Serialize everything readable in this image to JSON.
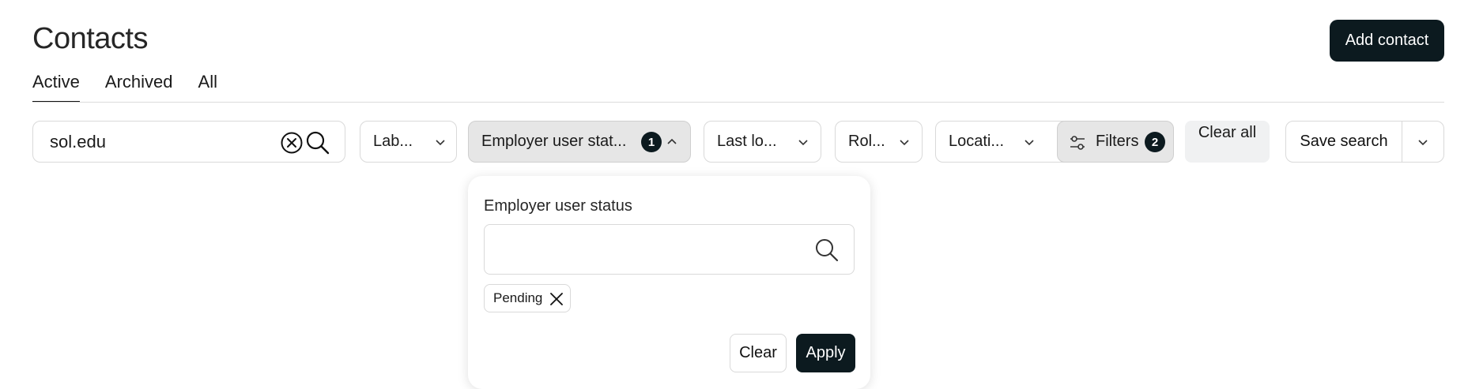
{
  "page": {
    "title": "Contacts",
    "add_button": "Add contact"
  },
  "tabs": [
    {
      "label": "Active",
      "active": true
    },
    {
      "label": "Archived",
      "active": false
    },
    {
      "label": "All",
      "active": false
    }
  ],
  "search": {
    "value": "sol.edu"
  },
  "filters": {
    "labels": "Lab...",
    "employer_status": {
      "label": "Employer user stat...",
      "count": "1"
    },
    "last_login": "Last lo...",
    "role": "Rol...",
    "location": "Locati...",
    "more_filters": {
      "label": "Filters",
      "count": "2"
    },
    "clear_all": "Clear all",
    "save_search": "Save search"
  },
  "popover": {
    "title": "Employer user status",
    "search_value": "",
    "selected_tags": [
      "Pending"
    ],
    "clear_label": "Clear",
    "apply_label": "Apply"
  },
  "colors": {
    "primary": "#0c1a1f",
    "chip_open_bg": "#e6e6e6",
    "border": "#d9d9d9"
  }
}
